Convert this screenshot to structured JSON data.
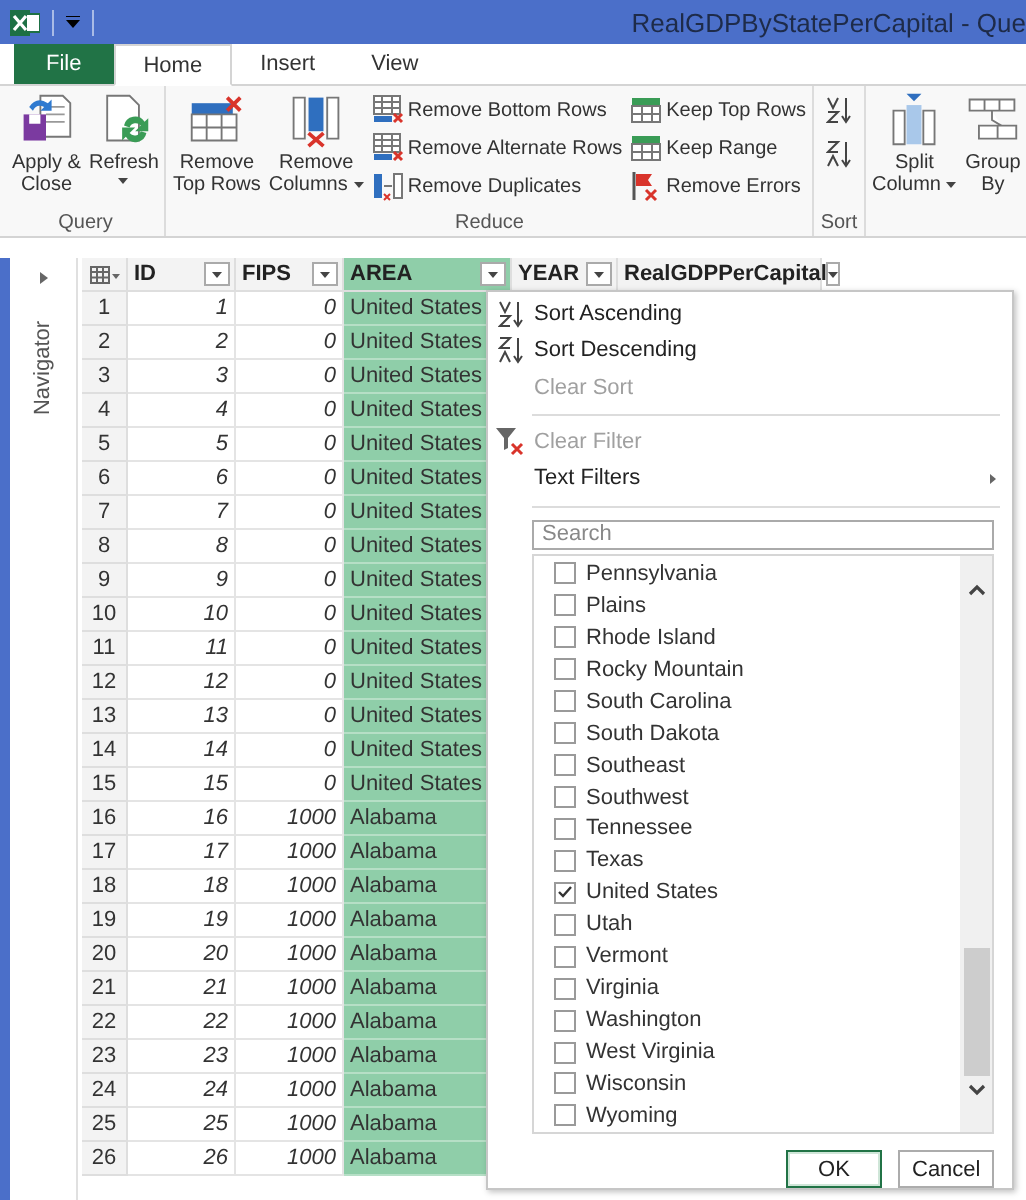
{
  "window": {
    "title": "RealGDPByStatePerCapital - Que"
  },
  "ribbon_tabs": [
    {
      "label": "File",
      "kind": "file",
      "selected": false
    },
    {
      "label": "Home",
      "kind": "tab",
      "selected": true
    },
    {
      "label": "Insert",
      "kind": "tab",
      "selected": false
    },
    {
      "label": "View",
      "kind": "tab",
      "selected": false
    }
  ],
  "ribbon_groups": [
    {
      "label": "Query",
      "items": [
        {
          "kind": "large",
          "lines": [
            "Apply &",
            "Close"
          ]
        },
        {
          "kind": "large",
          "lines": [
            "Refresh"
          ],
          "dropdown": true
        }
      ]
    },
    {
      "label": "Reduce",
      "items": [
        {
          "kind": "large",
          "lines": [
            "Remove",
            "Top Rows"
          ]
        },
        {
          "kind": "large",
          "lines": [
            "Remove",
            "Columns"
          ],
          "dropdown": true
        },
        {
          "kind": "stack",
          "buttons": [
            {
              "label": "Remove Bottom Rows"
            },
            {
              "label": "Remove Alternate Rows"
            },
            {
              "label": "Remove Duplicates"
            }
          ]
        },
        {
          "kind": "stack",
          "buttons": [
            {
              "label": "Keep Top Rows"
            },
            {
              "label": "Keep Range"
            },
            {
              "label": "Remove Errors"
            }
          ]
        }
      ]
    },
    {
      "label": "Sort",
      "items": [
        {
          "kind": "sort"
        }
      ]
    },
    {
      "items": [
        {
          "kind": "large",
          "lines": [
            "Split",
            "Column"
          ],
          "dropdown": true
        },
        {
          "kind": "large",
          "lines": [
            "Group",
            "By"
          ]
        }
      ]
    }
  ],
  "navigator": {
    "label": "Navigator"
  },
  "table": {
    "columns": [
      {
        "label": "ID",
        "kind": "number",
        "selected": false
      },
      {
        "label": "FIPS",
        "kind": "number",
        "selected": false
      },
      {
        "label": "AREA",
        "kind": "text",
        "selected": true
      },
      {
        "label": "YEAR",
        "kind": "number",
        "selected": false
      },
      {
        "label": "RealGDPPerCapital",
        "kind": "number",
        "selected": false
      }
    ],
    "rows": [
      {
        "row_number": "1",
        "cells": [
          "1",
          "0",
          "United States"
        ]
      },
      {
        "row_number": "2",
        "cells": [
          "2",
          "0",
          "United States"
        ]
      },
      {
        "row_number": "3",
        "cells": [
          "3",
          "0",
          "United States"
        ]
      },
      {
        "row_number": "4",
        "cells": [
          "4",
          "0",
          "United States"
        ]
      },
      {
        "row_number": "5",
        "cells": [
          "5",
          "0",
          "United States"
        ]
      },
      {
        "row_number": "6",
        "cells": [
          "6",
          "0",
          "United States"
        ]
      },
      {
        "row_number": "7",
        "cells": [
          "7",
          "0",
          "United States"
        ]
      },
      {
        "row_number": "8",
        "cells": [
          "8",
          "0",
          "United States"
        ]
      },
      {
        "row_number": "9",
        "cells": [
          "9",
          "0",
          "United States"
        ]
      },
      {
        "row_number": "10",
        "cells": [
          "10",
          "0",
          "United States"
        ]
      },
      {
        "row_number": "11",
        "cells": [
          "11",
          "0",
          "United States"
        ]
      },
      {
        "row_number": "12",
        "cells": [
          "12",
          "0",
          "United States"
        ]
      },
      {
        "row_number": "13",
        "cells": [
          "13",
          "0",
          "United States"
        ]
      },
      {
        "row_number": "14",
        "cells": [
          "14",
          "0",
          "United States"
        ]
      },
      {
        "row_number": "15",
        "cells": [
          "15",
          "0",
          "United States"
        ]
      },
      {
        "row_number": "16",
        "cells": [
          "16",
          "1000",
          "Alabama"
        ]
      },
      {
        "row_number": "17",
        "cells": [
          "17",
          "1000",
          "Alabama"
        ]
      },
      {
        "row_number": "18",
        "cells": [
          "18",
          "1000",
          "Alabama"
        ]
      },
      {
        "row_number": "19",
        "cells": [
          "19",
          "1000",
          "Alabama"
        ]
      },
      {
        "row_number": "20",
        "cells": [
          "20",
          "1000",
          "Alabama"
        ]
      },
      {
        "row_number": "21",
        "cells": [
          "21",
          "1000",
          "Alabama"
        ]
      },
      {
        "row_number": "22",
        "cells": [
          "22",
          "1000",
          "Alabama"
        ]
      },
      {
        "row_number": "23",
        "cells": [
          "23",
          "1000",
          "Alabama"
        ]
      },
      {
        "row_number": "24",
        "cells": [
          "24",
          "1000",
          "Alabama"
        ]
      },
      {
        "row_number": "25",
        "cells": [
          "25",
          "1000",
          "Alabama"
        ]
      },
      {
        "row_number": "26",
        "cells": [
          "26",
          "1000",
          "Alabama"
        ]
      }
    ]
  },
  "filter_menu": {
    "items": [
      {
        "kind": "sort-ascending",
        "label": "Sort Ascending",
        "disabled": false
      },
      {
        "kind": "sort-descending",
        "label": "Sort Descending",
        "disabled": false
      },
      {
        "kind": "plain",
        "label": "Clear Sort",
        "disabled": true
      },
      {
        "kind": "separator"
      },
      {
        "kind": "clear-filter",
        "label": "Clear Filter",
        "disabled": true
      },
      {
        "kind": "submenu",
        "label": "Text Filters",
        "disabled": false
      },
      {
        "kind": "separator"
      }
    ],
    "search": {
      "placeholder": "Search"
    },
    "values": [
      {
        "label": "Pennsylvania",
        "checked": false
      },
      {
        "label": "Plains",
        "checked": false
      },
      {
        "label": "Rhode Island",
        "checked": false
      },
      {
        "label": "Rocky Mountain",
        "checked": false
      },
      {
        "label": "South Carolina",
        "checked": false
      },
      {
        "label": "South Dakota",
        "checked": false
      },
      {
        "label": "Southeast",
        "checked": false
      },
      {
        "label": "Southwest",
        "checked": false
      },
      {
        "label": "Tennessee",
        "checked": false
      },
      {
        "label": "Texas",
        "checked": false
      },
      {
        "label": "United States",
        "checked": true
      },
      {
        "label": "Utah",
        "checked": false
      },
      {
        "label": "Vermont",
        "checked": false
      },
      {
        "label": "Virginia",
        "checked": false
      },
      {
        "label": "Washington",
        "checked": false
      },
      {
        "label": "West Virginia",
        "checked": false
      },
      {
        "label": "Wisconsin",
        "checked": false
      },
      {
        "label": "Wyoming",
        "checked": false
      }
    ],
    "buttons": [
      {
        "label": "OK",
        "default": true
      },
      {
        "label": "Cancel",
        "default": false
      }
    ]
  }
}
